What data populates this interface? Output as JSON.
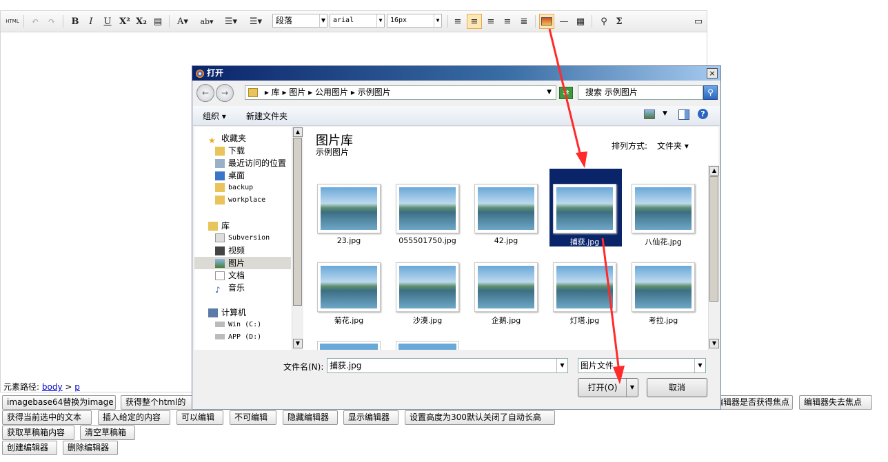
{
  "toolbar": {
    "html_label": "HTML",
    "paragraph": "段落",
    "font": "arial",
    "size": "16px"
  },
  "status": {
    "path_label": "元素路径:",
    "path_body": "body",
    "path_sep": ">",
    "path_p": "p"
  },
  "buttons": {
    "row1": [
      "imagebase64替换为image",
      "获得整个html的",
      "编辑器是否获得焦点",
      "编辑器失去焦点"
    ],
    "row2": [
      "获得当前选中的文本",
      "插入给定的内容",
      "可以编辑",
      "不可编辑",
      "隐藏编辑器",
      "显示编辑器",
      "设置高度为300默认关闭了自动长高"
    ],
    "row3": [
      "获取草稿箱内容",
      "清空草稿箱"
    ],
    "row4": [
      "创建编辑器",
      "删除编辑器"
    ]
  },
  "dialog": {
    "title": "打开",
    "close": "×",
    "address": [
      "库",
      "图片",
      "公用图片",
      "示例图片"
    ],
    "search_placeholder": "搜索 示例图片",
    "organize": "组织 ▾",
    "new_folder": "新建文件夹",
    "nav": {
      "favorites": "收藏夹",
      "downloads": "下载",
      "recent": "最近访问的位置",
      "desktop": "桌面",
      "backup": "backup",
      "workplace": "workplace",
      "libraries": "库",
      "subversion": "Subversion",
      "videos": "视频",
      "pictures": "图片",
      "documents": "文档",
      "music": "音乐",
      "computer": "计算机",
      "win": "Win (C:)",
      "app": "APP (D:)"
    },
    "library_title": "图片库",
    "library_sub": "示例图片",
    "arrange_label": "排列方式:",
    "arrange_value": "文件夹 ▾",
    "files": [
      "23.jpg",
      "055501750.jpg",
      "42.jpg",
      "捕获.jpg",
      "八仙花.jpg",
      "菊花.jpg",
      "沙漠.jpg",
      "企鹅.jpg",
      "灯塔.jpg",
      "考拉.jpg"
    ],
    "filename_label": "文件名(N):",
    "filename_value": "捕获.jpg",
    "filetype_value": "图片文件",
    "open_button": "打开(O)",
    "cancel_button": "取消"
  },
  "colors": {
    "accent_arrow": "#ff2a2a",
    "selection": "#0a246a",
    "title_bar": "#0a246a"
  }
}
